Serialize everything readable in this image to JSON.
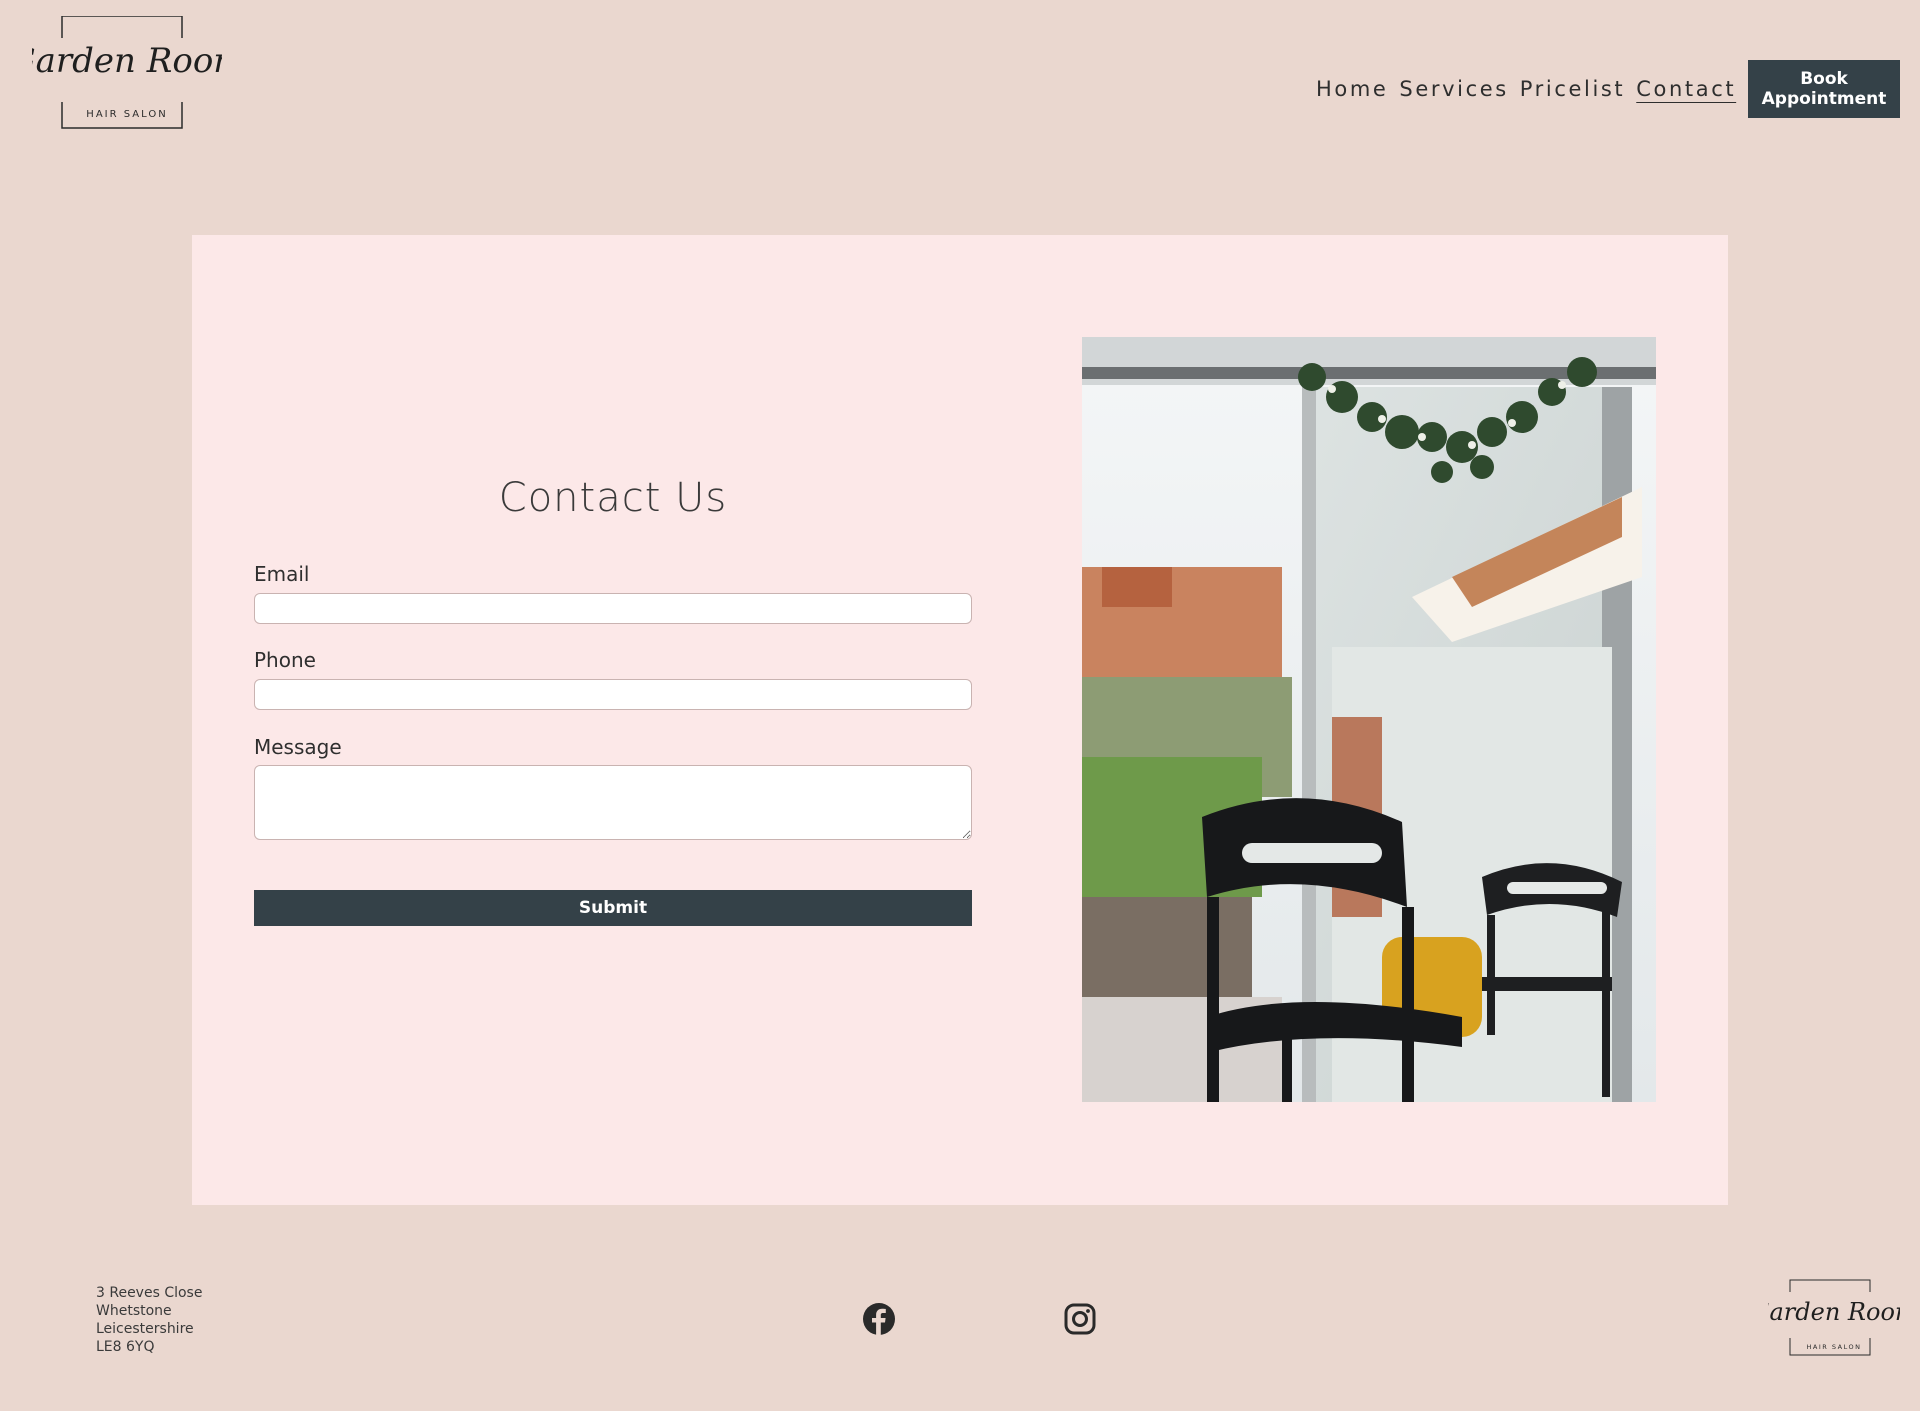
{
  "brand": {
    "logo_script": "Garden Room",
    "logo_sub": "HAIR SALON"
  },
  "nav": {
    "items": [
      {
        "label": "Home",
        "active": false
      },
      {
        "label": "Services",
        "active": false
      },
      {
        "label": "Pricelist",
        "active": false
      },
      {
        "label": "Contact",
        "active": true
      }
    ],
    "book_label": "Book Appointment"
  },
  "contact": {
    "title": "Contact Us",
    "email_label": "Email",
    "email_value": "",
    "phone_label": "Phone",
    "phone_value": "",
    "message_label": "Message",
    "message_value": "",
    "submit_label": "Submit"
  },
  "footer": {
    "address": [
      "3 Reeves Close",
      "Whetstone",
      "Leicestershire",
      "LE8 6YQ"
    ],
    "social": [
      {
        "icon": "facebook-icon"
      },
      {
        "icon": "instagram-icon"
      }
    ]
  },
  "colors": {
    "page_bg": "#ead7cf",
    "card_bg": "#fce8e8",
    "button_bg": "#344148",
    "button_text": "#ffffff"
  }
}
